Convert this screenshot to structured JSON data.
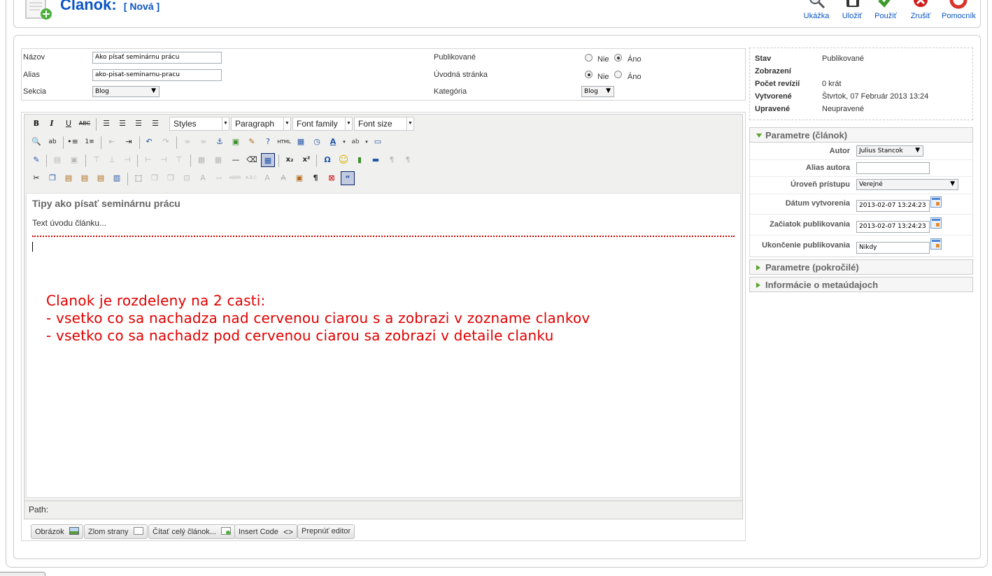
{
  "header": {
    "title": "Clanok:",
    "subtitle": "[ Nová ]"
  },
  "toolbar": {
    "preview": "Ukážka",
    "save": "Uložiť",
    "apply": "Použiť",
    "cancel": "Zrušiť",
    "help": "Pomocník"
  },
  "details": {
    "title_label": "Názov",
    "title_value": "Ako písať seminárnu prácu",
    "alias_label": "Alias",
    "alias_value": "ako-pisat-seminarnu-pracu",
    "section_label": "Sekcia",
    "section_value": "Blog",
    "published_label": "Publikované",
    "frontpage_label": "Úvodná stránka",
    "category_label": "Kategória",
    "category_value": "Blog",
    "no": "Nie",
    "yes": "Áno",
    "published_selected": "Áno",
    "frontpage_selected": "Nie"
  },
  "editor": {
    "dropdowns": [
      "Styles",
      "Paragraph",
      "Font family",
      "Font size"
    ],
    "heading": "Tipy ako písať seminárnu prácu",
    "intro": "Text úvodu článku...",
    "note_lines": [
      "Clanok je rozdeleny na 2 casti:",
      "- vsetko co sa nachadza nad cervenou ciarou s a zobrazi v zozname clankov",
      "- vsetko co sa nachadz pod cervenou ciarou sa zobrazi v detaile clanku"
    ],
    "path_label": "Path:",
    "buttons": {
      "image": "Obrázok",
      "pagebreak": "Zlom strany",
      "readmore": "Čítať celý článok...",
      "insert_code": "Insert Code",
      "toggle": "Prepnúť editor"
    }
  },
  "info": {
    "state_label": "Stav",
    "state_value": "Publikované",
    "hits_label": "Zobrazení",
    "hits_value": "",
    "revisions_label": "Počet revízií",
    "revisions_value": "0 krát",
    "created_label": "Vytvorené",
    "created_value": "Štvrtok, 07 Február 2013 13:24",
    "modified_label": "Upravené",
    "modified_value": "Neupravené"
  },
  "params": {
    "panel_article": "Parametre (článok)",
    "panel_advanced": "Parametre (pokročilé)",
    "panel_meta": "Informácie o metaúdajoch",
    "author_label": "Autor",
    "author_value": "Julius Stancok",
    "alias_author_label": "Alias autora",
    "alias_author_value": "",
    "access_label": "Úroveň prístupu",
    "access_value": "Verejné",
    "created_label": "Dátum vytvorenia",
    "created_value": "2013-02-07 13:24:23",
    "publish_up_label": "Začiatok publikovania",
    "publish_up_value": "2013-02-07 13:24:23",
    "publish_down_label": "Ukončenie publikovania",
    "publish_down_value": "Nikdy"
  },
  "colors": {
    "accent": "#0b55c4",
    "note_red": "#e00000",
    "readmore_line": "#cc0000",
    "panel_arrow": "#5aa52c"
  }
}
